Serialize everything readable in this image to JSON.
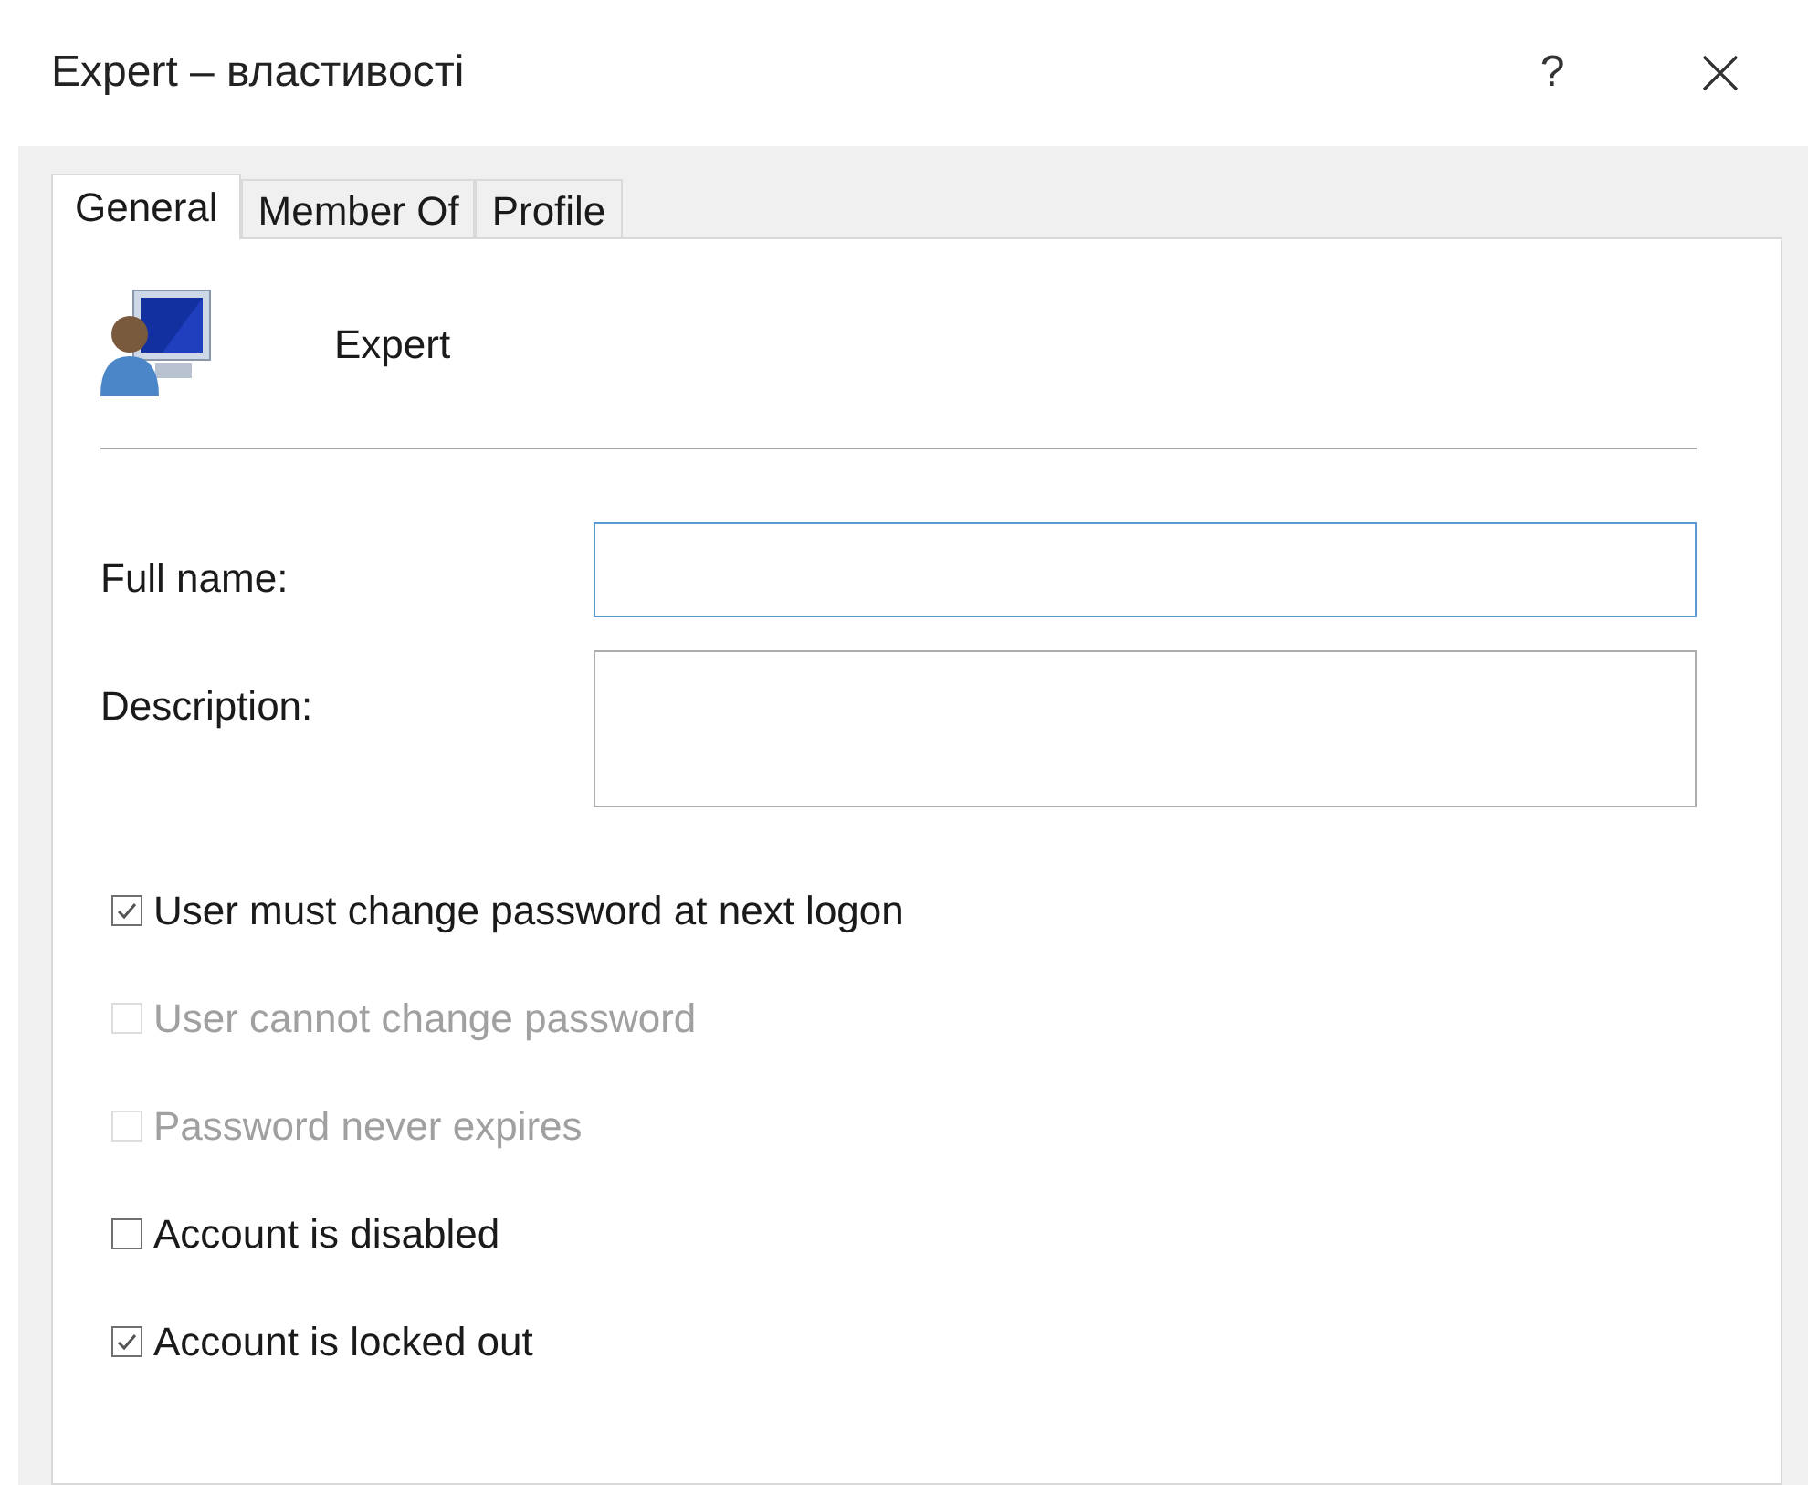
{
  "window": {
    "title": "Expert – властивості",
    "help": "?"
  },
  "tabs": [
    {
      "label": "General",
      "selected": true
    },
    {
      "label": "Member Of",
      "selected": false
    },
    {
      "label": "Profile",
      "selected": false
    }
  ],
  "user": {
    "name": "Expert"
  },
  "fields": [
    {
      "label": "Full name:",
      "focused": true,
      "kind": "line"
    },
    {
      "label": "Description:",
      "focused": false,
      "kind": "area"
    }
  ],
  "options": [
    {
      "label": "User must change password at next logon",
      "checked": true,
      "disabled": false
    },
    {
      "label": "User cannot change password",
      "checked": false,
      "disabled": true
    },
    {
      "label": "Password never expires",
      "checked": false,
      "disabled": true
    },
    {
      "label": "Account is disabled",
      "checked": false,
      "disabled": false
    },
    {
      "label": "Account is locked out",
      "checked": true,
      "disabled": false
    }
  ]
}
